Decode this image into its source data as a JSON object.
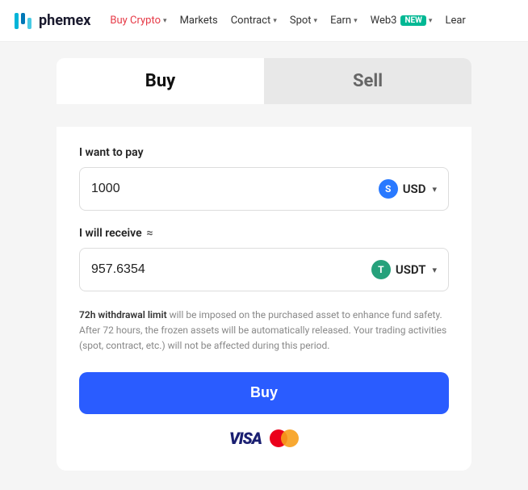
{
  "nav": {
    "logo_text": "phemex",
    "items": [
      {
        "label": "Buy Crypto",
        "has_chevron": true,
        "active": true
      },
      {
        "label": "Markets",
        "has_chevron": false,
        "active": false
      },
      {
        "label": "Contract",
        "has_chevron": true,
        "active": false
      },
      {
        "label": "Spot",
        "has_chevron": true,
        "active": false
      },
      {
        "label": "Earn",
        "has_chevron": true,
        "active": false
      },
      {
        "label": "Web3",
        "has_badge": true,
        "badge_text": "NEW",
        "has_chevron": true,
        "active": false
      },
      {
        "label": "Lear",
        "has_chevron": false,
        "active": false
      }
    ]
  },
  "tabs": [
    {
      "label": "Buy",
      "active": true
    },
    {
      "label": "Sell",
      "active": false
    }
  ],
  "form": {
    "pay_label": "I want to pay",
    "receive_label": "I will receive",
    "approx_symbol": "≈",
    "pay_value": "1000",
    "pay_currency_symbol": "S",
    "pay_currency_label": "USD",
    "receive_value": "957.6354",
    "receive_currency_symbol": "T",
    "receive_currency_label": "USDT",
    "notice_bold": "72h withdrawal limit",
    "notice_text": " will be imposed on the purchased asset to enhance fund safety. After 72 hours, the frozen assets will be automatically released. Your trading activities (spot, contract, etc.) will not be affected during this period.",
    "buy_button_label": "Buy"
  },
  "payment": {
    "visa_label": "VISA",
    "mc_label": "mastercard"
  }
}
